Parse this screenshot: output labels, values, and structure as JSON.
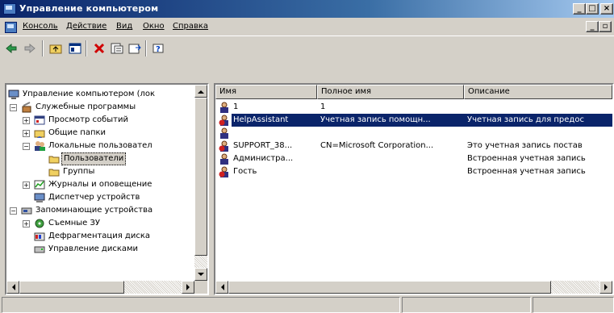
{
  "window": {
    "title": "Управление компьютером",
    "icon": "computer-management-icon"
  },
  "menubar": {
    "items": [
      "Консоль",
      "Действие",
      "Вид",
      "Окно",
      "Справка"
    ]
  },
  "toolbar": {
    "buttons": [
      "back-arrow-icon",
      "forward-arrow-icon",
      "up-folder-icon",
      "show-tree-icon",
      "delete-icon",
      "properties-icon",
      "export-list-icon",
      "help-icon"
    ]
  },
  "tree": {
    "items": [
      {
        "label": "Управление компьютером (лок",
        "icon": "computer-management-icon"
      },
      {
        "label": "Служебные программы",
        "icon": "tools-icon"
      },
      {
        "label": "Просмотр событий",
        "icon": "event-viewer-icon"
      },
      {
        "label": "Общие папки",
        "icon": "shared-folders-icon"
      },
      {
        "label": "Локальные пользовател",
        "icon": "local-users-icon"
      },
      {
        "label": "Пользователи",
        "icon": "folder-icon"
      },
      {
        "label": "Группы",
        "icon": "folder-icon"
      },
      {
        "label": "Журналы и оповещение",
        "icon": "logs-icon"
      },
      {
        "label": "Диспетчер устройств",
        "icon": "device-manager-icon"
      },
      {
        "label": "Запоминающие устройства",
        "icon": "storage-icon"
      },
      {
        "label": "Съемные ЗУ",
        "icon": "removable-storage-icon"
      },
      {
        "label": "Дефрагментация диска",
        "icon": "defrag-icon"
      },
      {
        "label": "Управление дисками",
        "icon": "disk-management-icon"
      }
    ]
  },
  "list": {
    "columns": [
      "Имя",
      "Полное имя",
      "Описание"
    ],
    "rows": [
      {
        "name": "1",
        "full_name": "1",
        "description": ""
      },
      {
        "name": "HelpAssistant",
        "full_name": "Учетная запись помощн...",
        "description": "Учетная запись для предос"
      },
      {
        "name": "",
        "full_name": "",
        "description": ""
      },
      {
        "name": "SUPPORT_38...",
        "full_name": "CN=Microsoft Corporation...",
        "description": "Это учетная запись постав"
      },
      {
        "name": "Администра...",
        "full_name": "",
        "description": "Встроенная учетная запись"
      },
      {
        "name": "Гость",
        "full_name": "",
        "description": "Встроенная учетная запись"
      }
    ]
  },
  "colors": {
    "title_active": "#0a246a",
    "selection": "#0a246a",
    "face": "#d4d0c8"
  }
}
